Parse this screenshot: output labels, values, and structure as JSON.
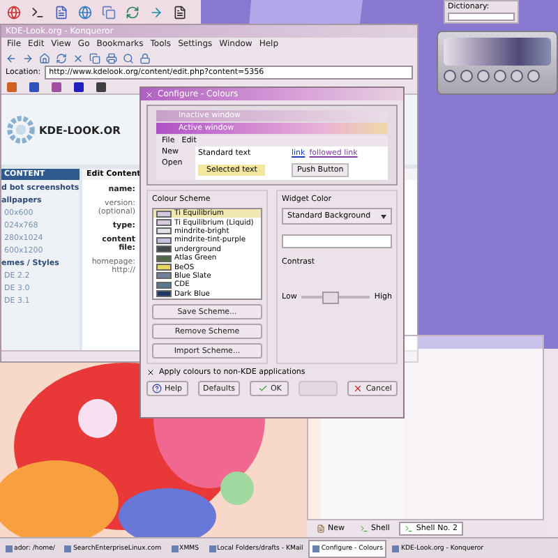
{
  "dictionary": {
    "label": "Dictionary:"
  },
  "browser": {
    "title": "KDE-Look.org - Konqueror",
    "menu": [
      "File",
      "Edit",
      "View",
      "Go",
      "Bookmarks",
      "Tools",
      "Settings",
      "Window",
      "Help"
    ],
    "location_label": "Location:",
    "url": "http://www.kdelook.org/content/edit.php?content=5356",
    "logo": "KDE-LOOK.OR",
    "sidebar": {
      "heading": "CONTENT",
      "items": [
        {
          "label": "d bot screenshots",
          "kind": "category"
        },
        {
          "label": "allpapers",
          "kind": "category"
        },
        {
          "label": "00x600",
          "kind": "item"
        },
        {
          "label": "024x768",
          "kind": "item"
        },
        {
          "label": "280x1024",
          "kind": "item"
        },
        {
          "label": "600x1200",
          "kind": "item"
        },
        {
          "label": "emes / Styles",
          "kind": "category"
        },
        {
          "label": "DE 2.2",
          "kind": "item"
        },
        {
          "label": "DE 3.0",
          "kind": "item"
        },
        {
          "label": "DE 3.1",
          "kind": "item"
        }
      ]
    },
    "form": {
      "heading": "Edit Content",
      "fields": [
        {
          "label": "name:",
          "kind": "bold"
        },
        {
          "label": "version:",
          "note": "(optional)",
          "kind": "plain"
        },
        {
          "label": "type:",
          "kind": "bold"
        },
        {
          "label": "content",
          "note": "file:",
          "kind": "bold"
        },
        {
          "label": "homepage:",
          "note": "http://",
          "kind": "plain"
        }
      ]
    }
  },
  "dialog": {
    "title": "Configure - Colours",
    "preview": {
      "inactive": "Inactive window",
      "active": "Active window",
      "menu": [
        "File",
        "Edit"
      ],
      "items": [
        "New",
        "Open"
      ],
      "standard": "Standard text",
      "selected": "Selected text",
      "link": "link",
      "followed": "followed link",
      "button": "Push Button"
    },
    "scheme_label": "Colour Scheme",
    "schemes": [
      {
        "label": "Ti Equilibrium",
        "selected": true,
        "color": "#d8c8e0"
      },
      {
        "label": "Ti Equilibrium (Liquid)",
        "selected": false,
        "color": "#d8c8e0"
      },
      {
        "label": "mindrite-bright",
        "selected": false,
        "color": "#e0e0e8"
      },
      {
        "label": "mindrite-tint-purple",
        "selected": false,
        "color": "#c8c0e0"
      },
      {
        "label": "underground",
        "selected": false,
        "color": "#404850"
      },
      {
        "label": "Atlas Green",
        "selected": false,
        "color": "#506848"
      },
      {
        "label": "BeOS",
        "selected": false,
        "color": "#e8d860"
      },
      {
        "label": "Blue Slate",
        "selected": false,
        "color": "#708098"
      },
      {
        "label": "CDE",
        "selected": false,
        "color": "#587890"
      },
      {
        "label": "Dark Blue",
        "selected": false,
        "color": "#203868"
      }
    ],
    "scheme_buttons": [
      "Save Scheme...",
      "Remove Scheme",
      "Import Scheme..."
    ],
    "widget_label": "Widget Color",
    "widget_value": "Standard Background",
    "contrast": {
      "label": "Contrast",
      "low": "Low",
      "high": "High",
      "level": 0.4
    },
    "apply_non_kde": {
      "label": "Apply colours to non-KDE applications",
      "checked": true
    },
    "buttons": [
      {
        "label": "Help",
        "kind": "help",
        "disabled": false
      },
      {
        "label": "Defaults",
        "kind": "plain",
        "disabled": false
      },
      {
        "label": "OK",
        "kind": "ok",
        "disabled": false
      },
      {
        "kind": "plain",
        "disabled": true
      },
      {
        "label": "Cancel",
        "kind": "cancel",
        "disabled": false
      }
    ]
  },
  "konsole": {
    "tabs": [
      {
        "label": "New",
        "kind": "new",
        "selected": false
      },
      {
        "label": "Shell",
        "kind": "shell",
        "selected": false
      },
      {
        "label": "Shell No. 2",
        "kind": "shell",
        "selected": true
      }
    ]
  },
  "taskbar": {
    "tasks": [
      {
        "label": "ador: /home/",
        "selected": false
      },
      {
        "label": "SearchEnterpriseLinux.com",
        "selected": false
      },
      {
        "label": "XMMS",
        "selected": false
      },
      {
        "label": "Local Folders/drafts - KMail",
        "selected": false
      },
      {
        "label": "Configure - Colours",
        "selected": true
      },
      {
        "label": "KDE-Look.org - Konqueror",
        "selected": false
      }
    ]
  }
}
